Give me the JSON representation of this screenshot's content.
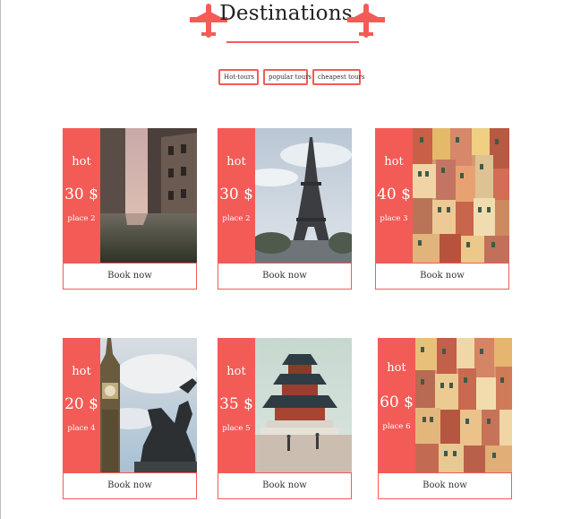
{
  "header": {
    "title": "Destinations",
    "left_icon": "airplane-icon",
    "right_icon": "airplane-icon"
  },
  "filters": [
    {
      "label": "Hot-tours"
    },
    {
      "label": "popular tours"
    },
    {
      "label": "cheapest tours"
    }
  ],
  "colors": {
    "accent": "#f35b57",
    "background": "#ffffff"
  },
  "cards": [
    {
      "tag": "hot",
      "price": "30 $",
      "place": "place 2",
      "button": "Book now",
      "image": "venice-canal"
    },
    {
      "tag": "hot",
      "price": "30 $",
      "place": "place 2",
      "button": "Book now",
      "image": "eiffel-tower"
    },
    {
      "tag": "hot",
      "price": "40 $",
      "place": "place 3",
      "button": "Book now",
      "image": "colorful-houses"
    },
    {
      "tag": "hot",
      "price": "20 $",
      "place": "place 4",
      "button": "Book now",
      "image": "big-ben"
    },
    {
      "tag": "hot",
      "price": "35 $",
      "place": "place 5",
      "button": "Book now",
      "image": "temple-of-heaven"
    },
    {
      "tag": "hot",
      "price": "60 $",
      "place": "place 6",
      "button": "Book now",
      "image": "colorful-houses"
    }
  ]
}
